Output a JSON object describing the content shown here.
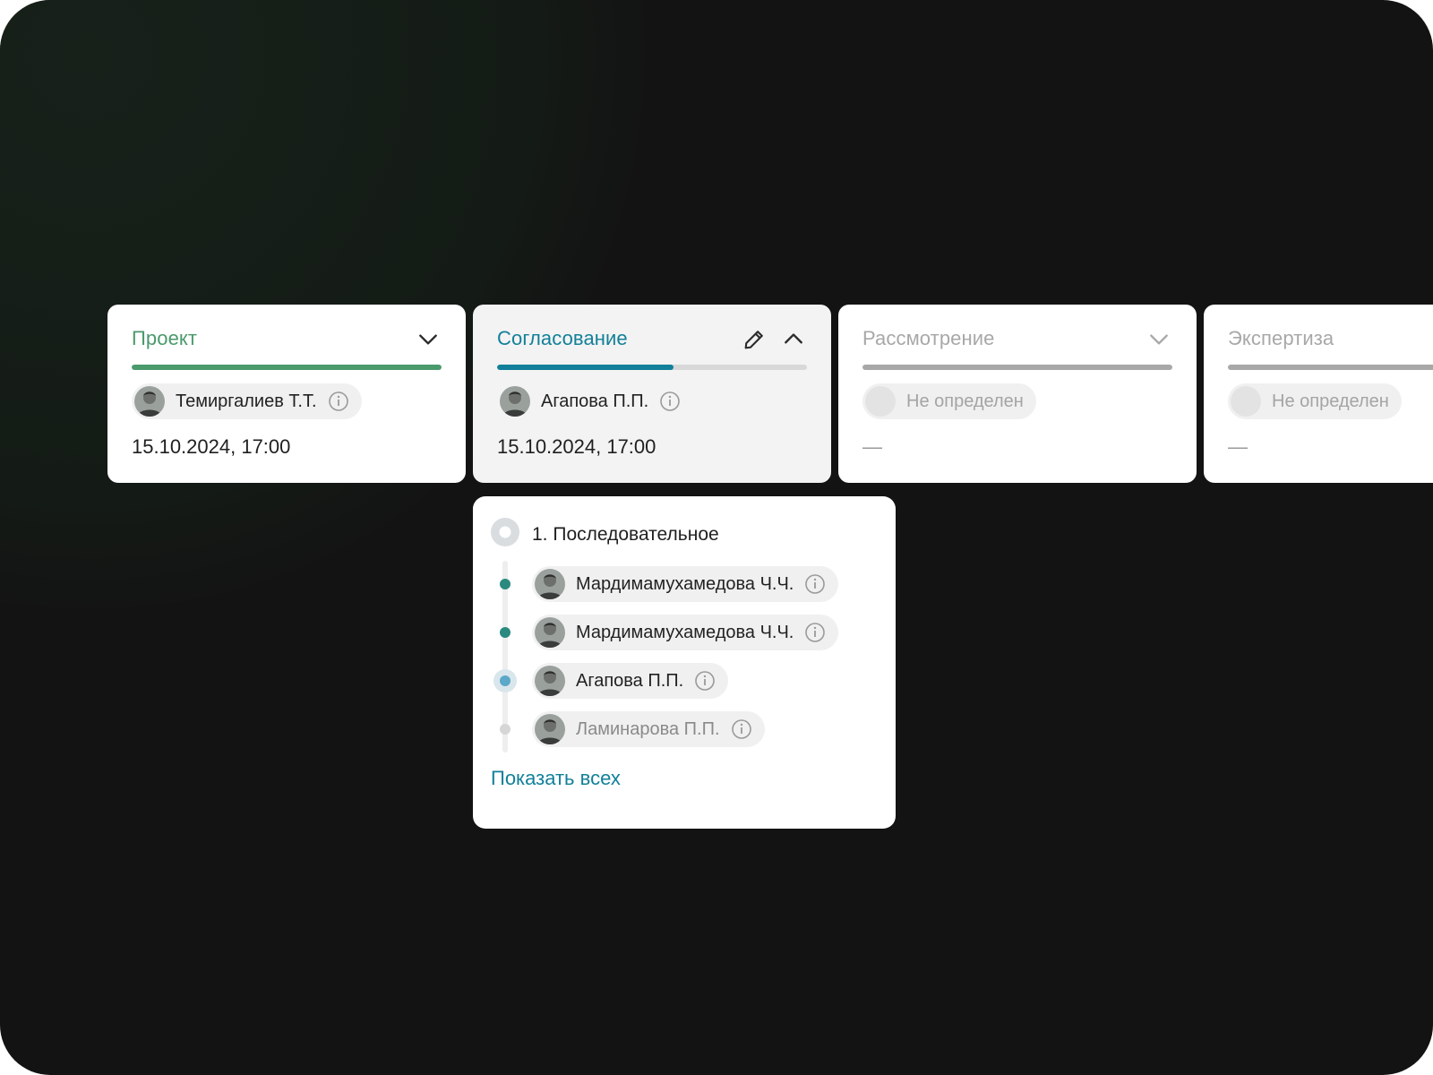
{
  "colors": {
    "background": "#131313",
    "done_green": "#4a9a6c",
    "active_teal": "#12809a",
    "pending_gray": "#a8a8a8",
    "dot_done": "#2a8a7f",
    "dot_current": "#5ba8c8",
    "dot_pending": "#d6d6d6"
  },
  "stages": [
    {
      "title": "Проект",
      "status": "done",
      "progress": 1.0,
      "assignee": "Темиргалиев Т.Т.",
      "date": "15.10.2024, 17:00",
      "control_icon": "chevron-down-icon"
    },
    {
      "title": "Согласование",
      "status": "active",
      "progress": 0.57,
      "assignee": "Агапова П.П.",
      "date": "15.10.2024, 17:00",
      "control_icon": "chevron-up-icon",
      "edit_icon": "pencil-icon"
    },
    {
      "title": "Рассмотрение",
      "status": "pending",
      "progress": 1.0,
      "assignee": "Не определен",
      "date": "—",
      "control_icon": "chevron-down-icon"
    },
    {
      "title": "Экспертиза",
      "status": "pending",
      "progress": 1.0,
      "assignee": "Не определен",
      "date": "—"
    }
  ],
  "popover": {
    "title": "1. Последовательное",
    "steps": [
      {
        "name": "Мардимамухамедова Ч.Ч.",
        "state": "done"
      },
      {
        "name": "Мардимамухамедова Ч.Ч.",
        "state": "done"
      },
      {
        "name": "Агапова П.П.",
        "state": "current"
      },
      {
        "name": "Ламинарова П.П.",
        "state": "pending"
      }
    ],
    "show_all_label": "Показать всех"
  }
}
